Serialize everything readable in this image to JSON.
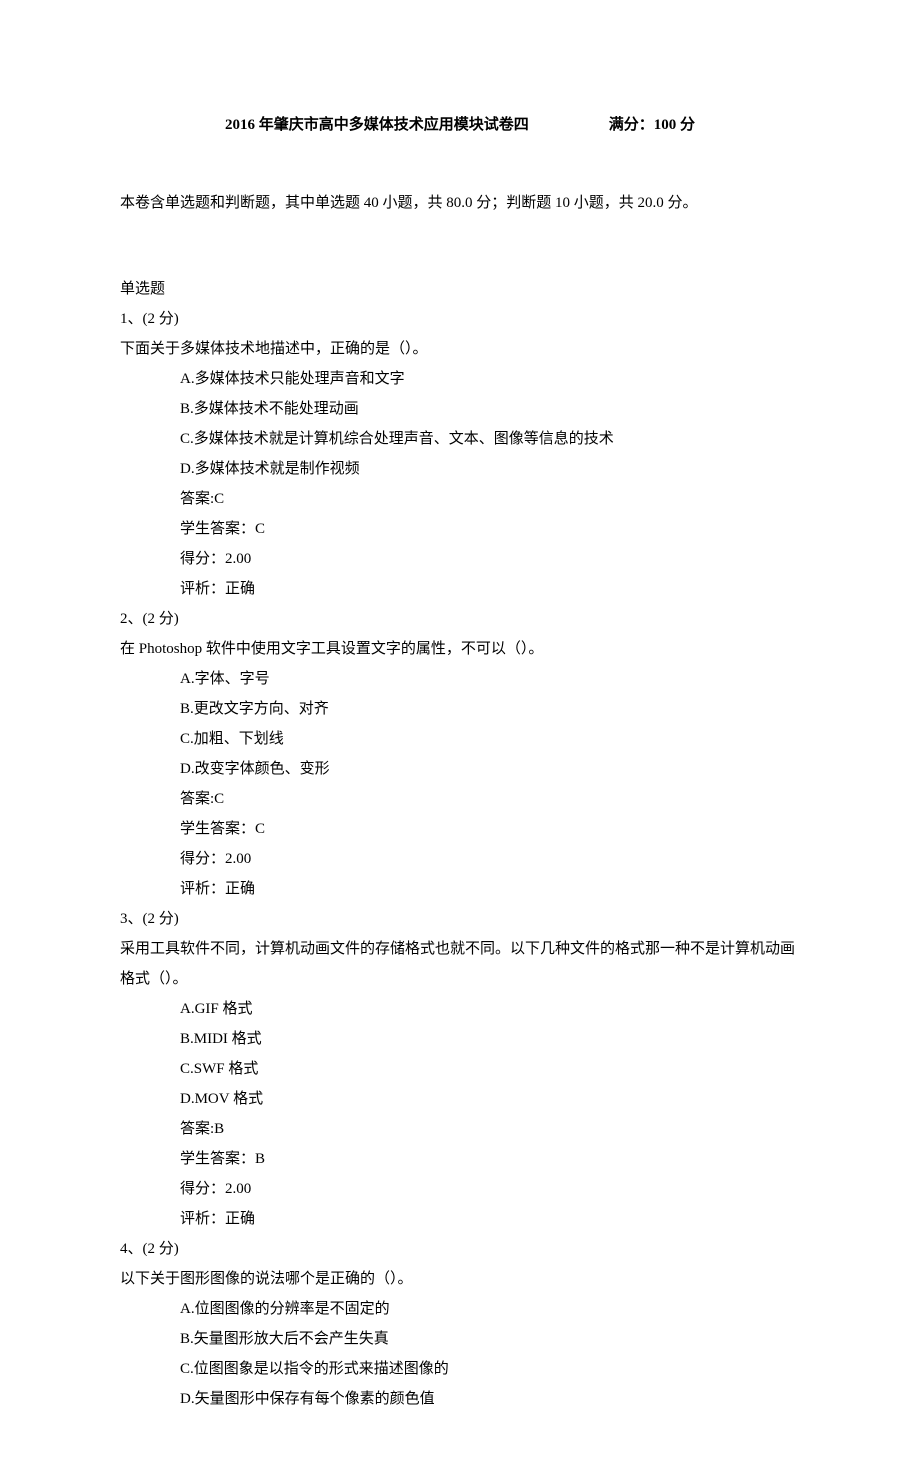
{
  "header": {
    "title": "2016 年肇庆市高中多媒体技术应用模块试卷四",
    "full_score_label": "满分：100 分"
  },
  "intro": "本卷含单选题和判断题，其中单选题 40 小题，共 80.0 分；判断题 10 小题，共 20.0 分。",
  "section_title": "单选题",
  "questions": [
    {
      "num_points": "1、(2 分)",
      "prompt": "下面关于多媒体技术地描述中，正确的是（）。",
      "options": [
        "A.多媒体技术只能处理声音和文字",
        "B.多媒体技术不能处理动画",
        "C.多媒体技术就是计算机综合处理声音、文本、图像等信息的技术",
        "D.多媒体技术就是制作视频"
      ],
      "answer": "答案:C",
      "student_answer": "学生答案：C",
      "score": "得分：2.00",
      "review": "评析：正确"
    },
    {
      "num_points": "2、(2 分)",
      "prompt": "在 Photoshop 软件中使用文字工具设置文字的属性，不可以（）。",
      "options": [
        "A.字体、字号",
        "B.更改文字方向、对齐",
        "C.加粗、下划线",
        "D.改变字体颜色、变形"
      ],
      "answer": "答案:C",
      "student_answer": "学生答案：C",
      "score": "得分：2.00",
      "review": "评析：正确"
    },
    {
      "num_points": "3、(2 分)",
      "prompt": "采用工具软件不同，计算机动画文件的存储格式也就不同。以下几种文件的格式那一种不是计算机动画格式（）。",
      "options": [
        "A.GIF 格式",
        "B.MIDI 格式",
        "C.SWF 格式",
        "D.MOV 格式"
      ],
      "answer": "答案:B",
      "student_answer": "学生答案：B",
      "score": "得分：2.00",
      "review": "评析：正确"
    },
    {
      "num_points": "4、(2 分)",
      "prompt": "以下关于图形图像的说法哪个是正确的（）。",
      "options": [
        "A.位图图像的分辨率是不固定的",
        "B.矢量图形放大后不会产生失真",
        "C.位图图象是以指令的形式来描述图像的",
        "D.矢量图形中保存有每个像素的颜色值"
      ]
    }
  ]
}
